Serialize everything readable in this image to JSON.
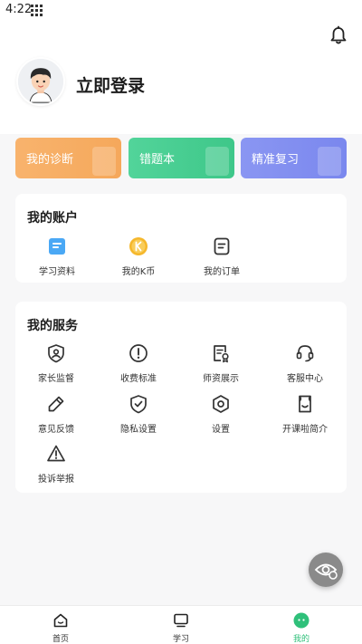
{
  "status_bar": {
    "time": "4:22"
  },
  "header": {
    "login_text": "立即登录",
    "bell_icon": "bell-icon"
  },
  "feature_cards": [
    {
      "label": "我的诊断",
      "color": "#f6ac60"
    },
    {
      "label": "错题本",
      "color": "#47cc90"
    },
    {
      "label": "精准复习",
      "color": "#8290f0"
    }
  ],
  "account": {
    "title": "我的账户",
    "items": [
      {
        "label": "学习资料",
        "icon": "study-material-icon",
        "color": "#4aa8f5"
      },
      {
        "label": "我的K币",
        "icon": "k-coin-icon",
        "color": "#f5b72b"
      },
      {
        "label": "我的订单",
        "icon": "order-icon",
        "color": "#333333"
      }
    ]
  },
  "services": {
    "title": "我的服务",
    "items": [
      {
        "label": "家长监督",
        "icon": "parent-supervision-icon"
      },
      {
        "label": "收费标准",
        "icon": "fee-standard-icon"
      },
      {
        "label": "师资展示",
        "icon": "teacher-showcase-icon"
      },
      {
        "label": "客服中心",
        "icon": "customer-service-icon"
      },
      {
        "label": "意见反馈",
        "icon": "feedback-icon"
      },
      {
        "label": "隐私设置",
        "icon": "privacy-icon"
      },
      {
        "label": "设置",
        "icon": "settings-icon"
      },
      {
        "label": "开课啦简介",
        "icon": "intro-icon"
      },
      {
        "label": "投诉举报",
        "icon": "report-icon"
      }
    ]
  },
  "floating_button": {
    "icon": "eye-protection-icon"
  },
  "tab_bar": {
    "tabs": [
      {
        "label": "首页",
        "icon": "home-icon",
        "active": false
      },
      {
        "label": "学习",
        "icon": "study-icon",
        "active": false
      },
      {
        "label": "我的",
        "icon": "profile-icon",
        "active": true
      }
    ],
    "active_color": "#2fc07a"
  }
}
